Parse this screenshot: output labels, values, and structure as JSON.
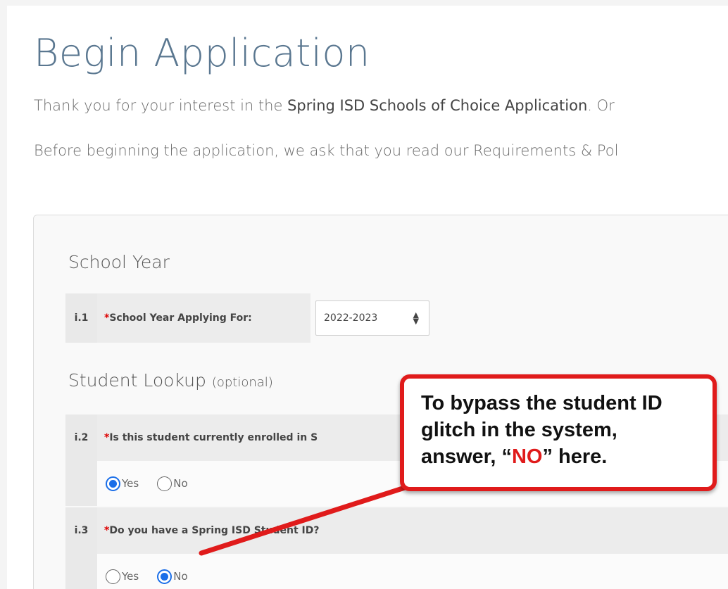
{
  "page": {
    "title": "Begin Application",
    "intro_1_prefix": "Thank you for your interest in the ",
    "intro_1_bold": "Spring ISD Schools of Choice Application",
    "intro_1_suffix": ". Or",
    "intro_2": "Before beginning the application, we ask that you read our Requirements & Pol"
  },
  "school_year": {
    "heading": "School Year",
    "q_num": "i.1",
    "q_label": "School Year Applying For:",
    "selected": "2022-2023"
  },
  "student_lookup": {
    "heading": "Student Lookup",
    "heading_note": "(optional)",
    "q2": {
      "num": "i.2",
      "label": "Is this student currently enrolled in S",
      "options": [
        "Yes",
        "No"
      ],
      "selected": "Yes"
    },
    "q3": {
      "num": "i.3",
      "label": "Do you have a Spring ISD Student ID?",
      "options": [
        "Yes",
        "No"
      ],
      "selected": "No"
    }
  },
  "callout": {
    "line1": "To bypass the student ID",
    "line2": "glitch in the system,",
    "line3_prefix": "answer, “",
    "line3_emph": "NO",
    "line3_suffix": "” here."
  },
  "colors": {
    "accent": "#1a6ee8",
    "required": "#dd0000",
    "callout_border": "#e01b1b",
    "title": "#5a7790"
  }
}
